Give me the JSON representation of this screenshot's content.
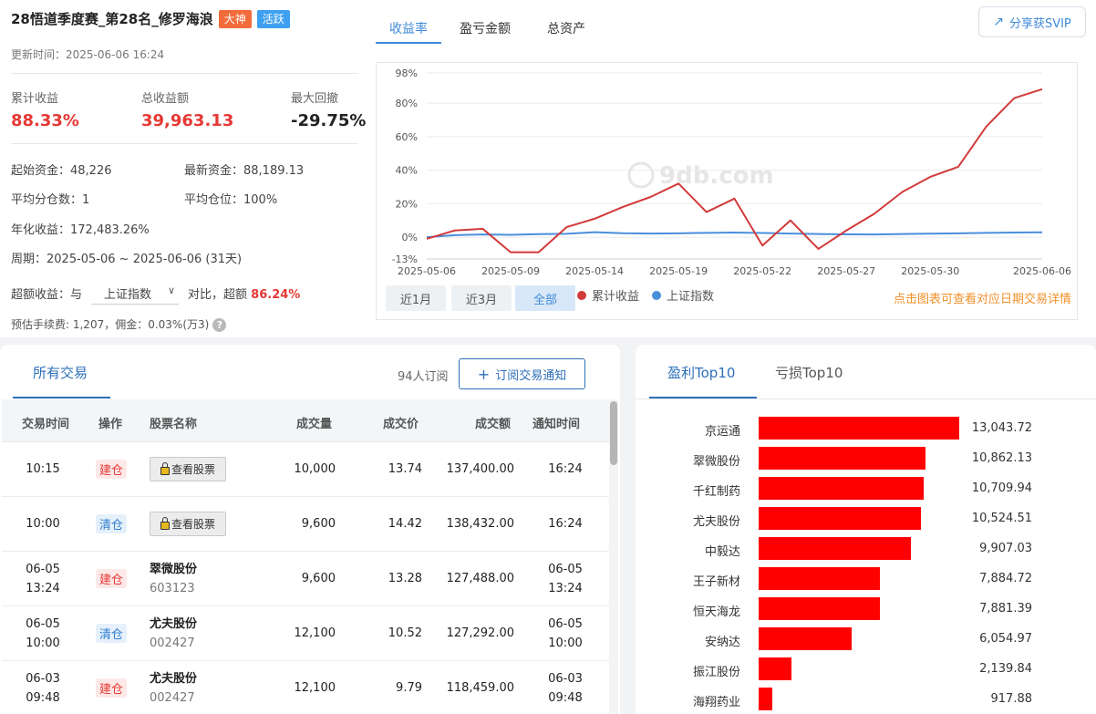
{
  "header": {
    "title": "28悟道季度赛_第28名_修罗海浪",
    "badge_master": "大神",
    "badge_active": "活跃",
    "update_label": "更新时间：",
    "update_time": "2025-06-06 16:24"
  },
  "stats": {
    "cum_return_label": "累计收益",
    "cum_return": "88.33%",
    "total_profit_label": "总收益额",
    "total_profit": "39,963.13",
    "max_drawdown_label": "最大回撤",
    "max_drawdown": "-29.75%"
  },
  "details": {
    "start_capital": "起始资金：48,226",
    "latest_capital": "最新资金：88,189.13",
    "avg_positions": "平均分仓数：1",
    "avg_position_ratio": "平均仓位：100%",
    "annual_return": "年化收益：172,483.26%",
    "period": "周期：2025-05-06 ~ 2025-06-06 (31天)",
    "excess_prefix": "超额收益：与",
    "benchmark": "上证指数",
    "excess_mid": "对比，超额",
    "excess_value": "86.24%",
    "fees": "预估手续费: 1,207，佣金：0.03%(万3)",
    "help": "?"
  },
  "top_tabs": [
    "收益率",
    "盈亏金额",
    "总资产"
  ],
  "share_label": "分享获SVIP",
  "range_buttons": [
    "近1月",
    "近3月",
    "全部"
  ],
  "legend": {
    "cum": "累计收益",
    "index": "上证指数",
    "cum_color": "#d23a3a",
    "index_color": "#4a8fdc"
  },
  "chart_hint": "点击图表可查看对应日期交易详情",
  "watermark": "9db.com",
  "chart_data": {
    "type": "line",
    "y_ticks": [
      "98%",
      "80%",
      "60%",
      "40%",
      "20%",
      "0%",
      "-13%"
    ],
    "y_tick_values": [
      98,
      80,
      60,
      40,
      20,
      0,
      -13
    ],
    "ylim": [
      -13,
      98
    ],
    "x_ticks": [
      "2025-05-06",
      "2025-05-09",
      "2025-05-14",
      "2025-05-19",
      "2025-05-22",
      "2025-05-27",
      "2025-05-30",
      "2025-06-06"
    ],
    "x_tick_index": [
      0,
      3,
      6,
      9,
      12,
      15,
      18,
      22
    ],
    "x_count": 23,
    "series": [
      {
        "name": "累计收益",
        "color": "#d23a3a",
        "values": [
          -1,
          4,
          5,
          -9,
          -9,
          6,
          11,
          18,
          24,
          32,
          15,
          23,
          -5,
          10,
          -7,
          4,
          14,
          27,
          36,
          42,
          66,
          83,
          88.33
        ]
      },
      {
        "name": "上证指数",
        "color": "#4a8fdc",
        "values": [
          0,
          1.2,
          1.6,
          1.4,
          1.8,
          2,
          3,
          2.4,
          2.2,
          2.3,
          2.6,
          2.8,
          2.5,
          2.2,
          1.9,
          1.7,
          1.6,
          1.9,
          2.1,
          2.3,
          2.6,
          2.8,
          2.9
        ]
      }
    ]
  },
  "trades": {
    "tab_label": "所有交易",
    "subscribers": "94人订阅",
    "subscribe_button": "订阅交易通知",
    "columns": [
      "交易时间",
      "操作",
      "股票名称",
      "成交量",
      "成交价",
      "成交额",
      "通知时间"
    ],
    "view_stock_label": "查看股票",
    "rows": [
      {
        "time1": "10:15",
        "time2": "",
        "op": "建仓",
        "op_type": "open",
        "locked": true,
        "name": "",
        "code": "",
        "volume": "10,000",
        "price": "13.74",
        "amount": "137,400.00",
        "notify1": "16:24",
        "notify2": ""
      },
      {
        "time1": "10:00",
        "time2": "",
        "op": "清仓",
        "op_type": "close",
        "locked": true,
        "name": "",
        "code": "",
        "volume": "9,600",
        "price": "14.42",
        "amount": "138,432.00",
        "notify1": "16:24",
        "notify2": ""
      },
      {
        "time1": "06-05",
        "time2": "13:24",
        "op": "建仓",
        "op_type": "open",
        "locked": false,
        "name": "翠微股份",
        "code": "603123",
        "volume": "9,600",
        "price": "13.28",
        "amount": "127,488.00",
        "notify1": "06-05",
        "notify2": "13:24"
      },
      {
        "time1": "06-05",
        "time2": "10:00",
        "op": "清仓",
        "op_type": "close",
        "locked": false,
        "name": "尤夫股份",
        "code": "002427",
        "volume": "12,100",
        "price": "10.52",
        "amount": "127,292.00",
        "notify1": "06-05",
        "notify2": "10:00"
      },
      {
        "time1": "06-03",
        "time2": "09:48",
        "op": "建仓",
        "op_type": "open",
        "locked": false,
        "name": "尤夫股份",
        "code": "002427",
        "volume": "12,100",
        "price": "9.79",
        "amount": "118,459.00",
        "notify1": "06-03",
        "notify2": "09:48"
      }
    ]
  },
  "top10": {
    "tab_profit": "盈利Top10",
    "tab_loss": "亏损Top10",
    "bar_color": "#ff0000",
    "items": [
      {
        "name": "京运通",
        "value": 13043.72,
        "label": "13,043.72"
      },
      {
        "name": "翠微股份",
        "value": 10862.13,
        "label": "10,862.13"
      },
      {
        "name": "千红制药",
        "value": 10709.94,
        "label": "10,709.94"
      },
      {
        "name": "尤夫股份",
        "value": 10524.51,
        "label": "10,524.51"
      },
      {
        "name": "中毅达",
        "value": 9907.03,
        "label": "9,907.03"
      },
      {
        "name": "王子新材",
        "value": 7884.72,
        "label": "7,884.72"
      },
      {
        "name": "恒天海龙",
        "value": 7881.39,
        "label": "7,881.39"
      },
      {
        "name": "安纳达",
        "value": 6054.97,
        "label": "6,054.97"
      },
      {
        "name": "振江股份",
        "value": 2139.84,
        "label": "2,139.84"
      },
      {
        "name": "海翔药业",
        "value": 917.88,
        "label": "917.88"
      }
    ]
  }
}
